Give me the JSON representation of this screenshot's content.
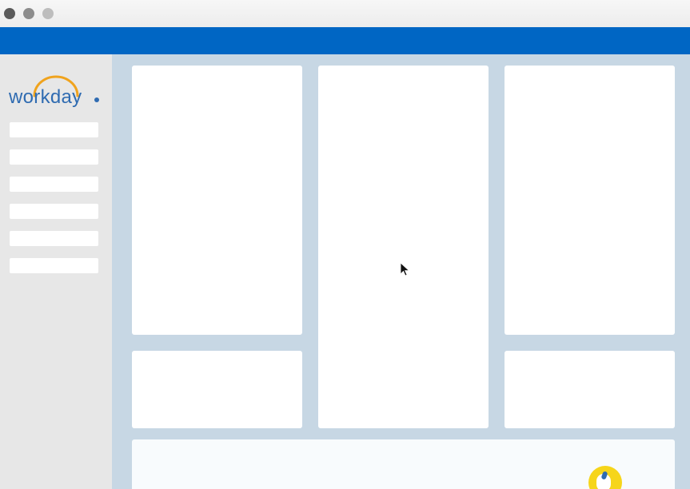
{
  "window": {
    "controls": [
      "close",
      "minimize",
      "maximize"
    ]
  },
  "brand": {
    "logo_text": "workday",
    "logo_icon": "workday-arc-logo",
    "text_color": "#2f6bb1",
    "arc_color": "#f0a31d"
  },
  "header": {
    "color": "#0066c4"
  },
  "sidebar": {
    "items": [
      {
        "label": ""
      },
      {
        "label": ""
      },
      {
        "label": ""
      },
      {
        "label": ""
      },
      {
        "label": ""
      },
      {
        "label": ""
      }
    ]
  },
  "dashboard": {
    "background_color": "#c7d7e4",
    "cards": [
      {
        "name": "card-top-left",
        "title": ""
      },
      {
        "name": "card-center-tall",
        "title": ""
      },
      {
        "name": "card-top-right",
        "title": ""
      },
      {
        "name": "card-bottom-left",
        "title": ""
      },
      {
        "name": "card-bottom-right",
        "title": ""
      },
      {
        "name": "card-wide-bottom",
        "title": ""
      }
    ]
  },
  "cursor": {
    "icon": "mouse-pointer-icon"
  },
  "assistant": {
    "icon": "assistant-icon",
    "color": "#f6d51a"
  }
}
